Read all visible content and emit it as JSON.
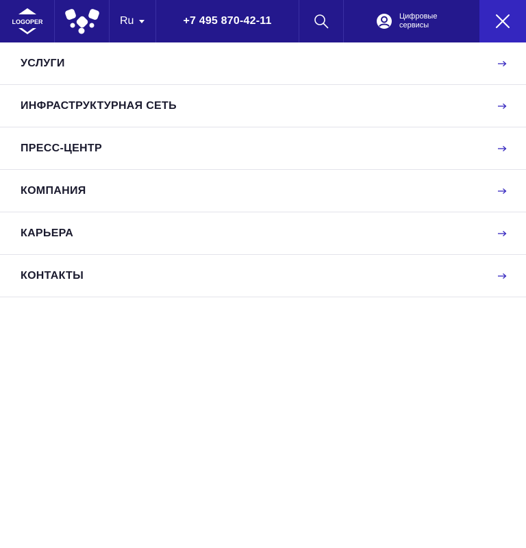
{
  "header": {
    "logo_text": "LOGOPER",
    "brand_mark": "brand-mark-icon",
    "language": "Ru",
    "phone": "+7 495 870-42-11",
    "search_icon": "search-icon",
    "digital_services": {
      "line1": "Цифровые",
      "line2": "сервисы",
      "icon": "user-circle-icon"
    },
    "close_icon": "close-icon"
  },
  "menu": {
    "items": [
      {
        "label": "УСЛУГИ"
      },
      {
        "label": "ИНФРАСТРУКТУРНАЯ СЕТЬ"
      },
      {
        "label": "ПРЕСС-ЦЕНТР"
      },
      {
        "label": "КОМПАНИЯ"
      },
      {
        "label": "КАРЬЕРА"
      },
      {
        "label": "КОНТАКТЫ"
      }
    ],
    "arrow_icon": "arrow-right-icon"
  },
  "colors": {
    "header_bg": "#24188d",
    "close_bg": "#3426bf",
    "menu_text": "#1a1a2e",
    "accent": "#3426bf"
  }
}
